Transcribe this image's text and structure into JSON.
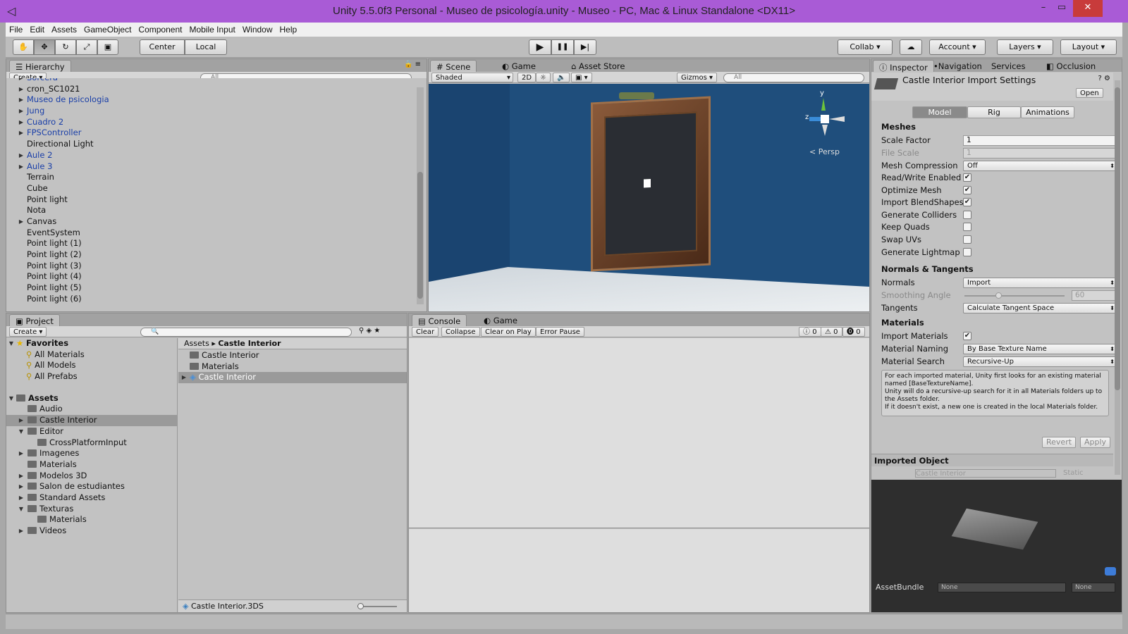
{
  "title": "Unity 5.5.0f3 Personal - Museo de psicología.unity - Museo - PC, Mac & Linux Standalone <DX11>",
  "window_controls": {
    "min": "–",
    "max": "▭",
    "close": "✕"
  },
  "menu": [
    "File",
    "Edit",
    "Assets",
    "GameObject",
    "Component",
    "Mobile Input",
    "Window",
    "Help"
  ],
  "toolbar": {
    "center": "Center",
    "local": "Local",
    "collab": "Collab",
    "account": "Account",
    "layers": "Layers",
    "layout": "Layout",
    "play": "▶",
    "pause": "❚❚",
    "step": "▶|"
  },
  "hierarchy": {
    "tab": "Hierarchy",
    "create": "Create",
    "search": "All",
    "items": [
      {
        "label": "Sorcera",
        "blue": true,
        "arrow": true
      },
      {
        "label": "cron_SC1021",
        "blue": false,
        "arrow": true
      },
      {
        "label": "Museo de psicologia",
        "blue": true,
        "arrow": true
      },
      {
        "label": "Jung",
        "blue": true,
        "arrow": true
      },
      {
        "label": "Cuadro 2",
        "blue": true,
        "arrow": true
      },
      {
        "label": "FPSController",
        "blue": true,
        "arrow": true
      },
      {
        "label": "Directional Light",
        "blue": false,
        "arrow": false
      },
      {
        "label": "Aule 2",
        "blue": true,
        "arrow": true
      },
      {
        "label": "Aule 3",
        "blue": true,
        "arrow": true
      },
      {
        "label": "Terrain",
        "blue": false,
        "arrow": false
      },
      {
        "label": "Cube",
        "blue": false,
        "arrow": false
      },
      {
        "label": "Point light",
        "blue": false,
        "arrow": false
      },
      {
        "label": "Nota",
        "blue": false,
        "arrow": false
      },
      {
        "label": "Canvas",
        "blue": false,
        "arrow": true
      },
      {
        "label": "EventSystem",
        "blue": false,
        "arrow": false
      },
      {
        "label": "Point light (1)",
        "blue": false,
        "arrow": false
      },
      {
        "label": "Point light (2)",
        "blue": false,
        "arrow": false
      },
      {
        "label": "Point light (3)",
        "blue": false,
        "arrow": false
      },
      {
        "label": "Point light (4)",
        "blue": false,
        "arrow": false
      },
      {
        "label": "Point light (5)",
        "blue": false,
        "arrow": false
      },
      {
        "label": "Point light (6)",
        "blue": false,
        "arrow": false
      }
    ]
  },
  "scene": {
    "tabs": [
      "Scene",
      "Game",
      "Asset Store"
    ],
    "shaded": "Shaded",
    "mode2d": "2D",
    "gizmos": "Gizmos",
    "search": "All",
    "persp": "< Persp",
    "axis_y": "y",
    "axis_z": "z"
  },
  "project": {
    "tab": "Project",
    "create": "Create",
    "favorites": {
      "label": "Favorites",
      "items": [
        "All Materials",
        "All Models",
        "All Prefabs"
      ]
    },
    "assets": {
      "label": "Assets",
      "items": [
        {
          "label": "Audio",
          "indent": 1,
          "arrow": ""
        },
        {
          "label": "Castle Interior",
          "indent": 1,
          "arrow": "▶",
          "selected": true
        },
        {
          "label": "Editor",
          "indent": 1,
          "arrow": "▼"
        },
        {
          "label": "CrossPlatformInput",
          "indent": 2,
          "arrow": ""
        },
        {
          "label": "Imagenes",
          "indent": 1,
          "arrow": "▶"
        },
        {
          "label": "Materials",
          "indent": 1,
          "arrow": ""
        },
        {
          "label": "Modelos 3D",
          "indent": 1,
          "arrow": "▶"
        },
        {
          "label": "Salon de estudiantes",
          "indent": 1,
          "arrow": "▶"
        },
        {
          "label": "Standard Assets",
          "indent": 1,
          "arrow": "▶"
        },
        {
          "label": "Texturas",
          "indent": 1,
          "arrow": "▼"
        },
        {
          "label": "Materials",
          "indent": 2,
          "arrow": ""
        },
        {
          "label": "Videos",
          "indent": 1,
          "arrow": "▶"
        }
      ]
    },
    "breadcrumb": {
      "root": "Assets",
      "sep": "▸",
      "current": "Castle Interior"
    },
    "files": [
      "Castle Interior",
      "Materials",
      "Castle Interior"
    ],
    "footer": "Castle Interior.3DS"
  },
  "console": {
    "tabs": [
      "Console",
      "Game"
    ],
    "buttons": [
      "Clear",
      "Collapse",
      "Clear on Play",
      "Error Pause"
    ],
    "counts": [
      "0",
      "0",
      "0"
    ]
  },
  "inspector": {
    "tabs": [
      "Inspector",
      "Navigation",
      "Services",
      "Occlusion"
    ],
    "header": "Castle Interior Import Settings",
    "open": "Open",
    "subtabs": [
      "Model",
      "Rig",
      "Animations"
    ],
    "meshes": "Meshes",
    "scale_factor": {
      "k": "Scale Factor",
      "v": "1"
    },
    "file_scale": {
      "k": "File Scale",
      "v": "1"
    },
    "mesh_compression": {
      "k": "Mesh Compression",
      "v": "Off"
    },
    "checks": [
      {
        "k": "Read/Write Enabled",
        "on": true
      },
      {
        "k": "Optimize Mesh",
        "on": true
      },
      {
        "k": "Import BlendShapes",
        "on": true
      },
      {
        "k": "Generate Colliders",
        "on": false
      },
      {
        "k": "Keep Quads",
        "on": false
      },
      {
        "k": "Swap UVs",
        "on": false
      },
      {
        "k": "Generate Lightmap U",
        "on": false
      }
    ],
    "normals_tangents": "Normals & Tangents",
    "normals": {
      "k": "Normals",
      "v": "Import"
    },
    "smoothing": {
      "k": "Smoothing Angle",
      "v": "60"
    },
    "tangents": {
      "k": "Tangents",
      "v": "Calculate Tangent Space"
    },
    "materials": "Materials",
    "import_materials": {
      "k": "Import Materials",
      "on": true
    },
    "material_naming": {
      "k": "Material Naming",
      "v": "By Base Texture Name"
    },
    "material_search": {
      "k": "Material Search",
      "v": "Recursive-Up"
    },
    "help": "For each imported material, Unity first looks for an existing material named [BaseTextureName].\nUnity will do a recursive-up search for it in all Materials folders up to the Assets folder.\nIf it doesn't exist, a new one is created in the local Materials folder.",
    "revert": "Revert",
    "apply": "Apply",
    "imported_object": "Imported Object",
    "object_name": "Castle Interior",
    "static": "Static",
    "assetbundle": "AssetBundle",
    "ab_none1": "None",
    "ab_none2": "None"
  },
  "colors": {
    "title": "#a95bd6",
    "scene_bg": "#1f4e7c",
    "panel": "#c2c2c2"
  }
}
